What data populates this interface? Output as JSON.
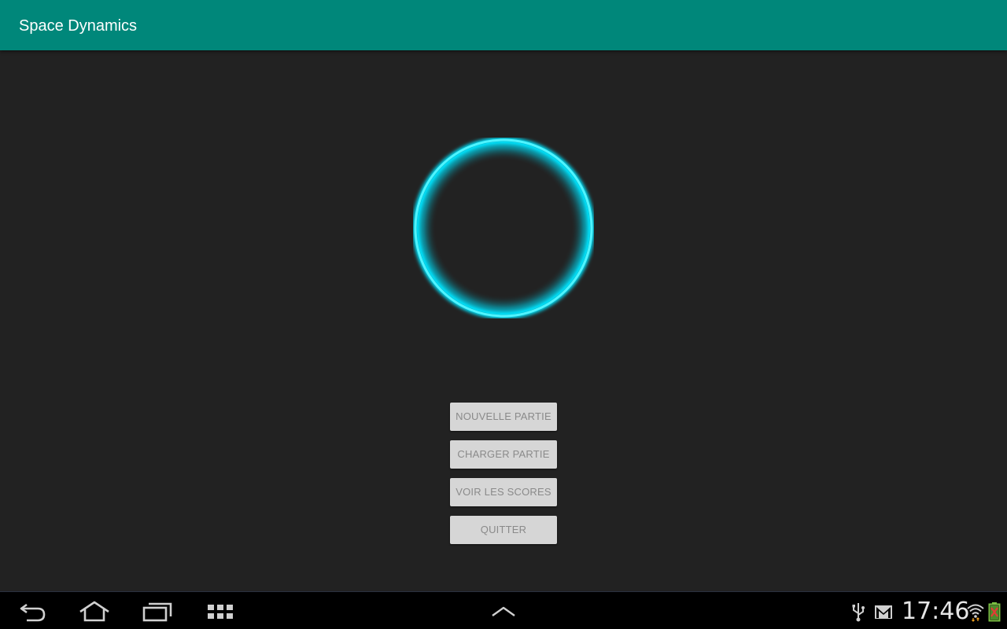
{
  "app": {
    "title": "Space Dynamics"
  },
  "logo": {
    "icon": "glowing-ring-icon",
    "ring_color": "#00e5ff"
  },
  "menu": {
    "new_game": "NOUVELLE PARTIE",
    "load_game": "CHARGER PARTIE",
    "view_scores": "VOIR LES SCORES",
    "quit": "QUITTER"
  },
  "navbar": {
    "back_icon": "back-icon",
    "home_icon": "home-icon",
    "recent_icon": "recent-apps-icon",
    "apps_icon": "app-grid-icon",
    "expand_icon": "chevron-up-icon"
  },
  "status": {
    "time": "17:46",
    "icons": [
      "usb-icon",
      "gmail-icon",
      "wifi-icon",
      "battery-icon"
    ]
  },
  "colors": {
    "app_bar": "#00877a",
    "background": "#222222",
    "button_bg": "#d6d6d6",
    "button_text": "#8a8a8a"
  }
}
